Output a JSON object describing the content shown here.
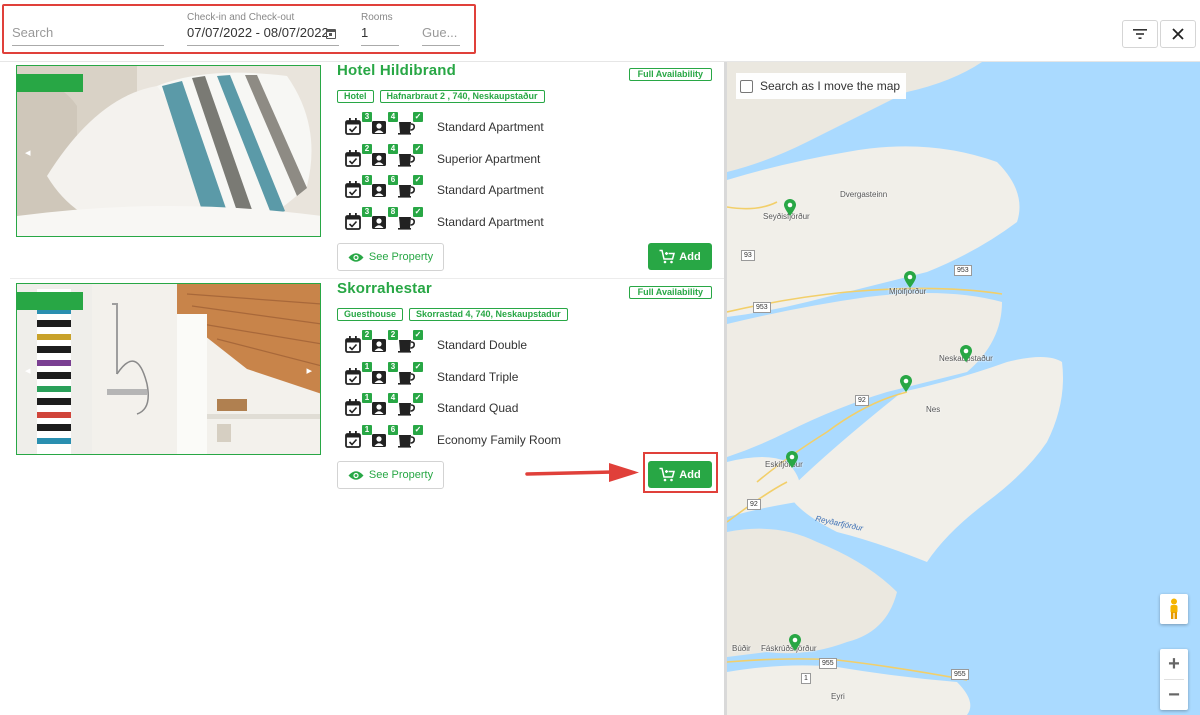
{
  "topbar": {
    "search": {
      "placeholder": "Search",
      "value": ""
    },
    "dates": {
      "label": "Check-in and Check-out",
      "value": "07/07/2022 - 08/07/2022"
    },
    "rooms": {
      "label": "Rooms",
      "value": "1"
    },
    "guests": {
      "placeholder": "Gue..."
    },
    "filter_icon": "filter-icon",
    "close_icon": "close-icon"
  },
  "properties": [
    {
      "name": "Hotel Hildibrand",
      "availability": "Full Availability",
      "type": "Hotel",
      "address": "Hafnarbraut 2 , 740, Neskaupstaður",
      "rooms": [
        {
          "name": "Standard Apartment",
          "a": "3",
          "b": "4"
        },
        {
          "name": "Superior Apartment",
          "a": "2",
          "b": "4"
        },
        {
          "name": "Standard Apartment",
          "a": "3",
          "b": "6"
        },
        {
          "name": "Standard Apartment",
          "a": "3",
          "b": "8"
        }
      ],
      "see_label": "See Property",
      "add_label": "Add"
    },
    {
      "name": "Skorrahestar",
      "availability": "Full Availability",
      "type": "Guesthouse",
      "address": "Skorrastad 4, 740, Neskaupstadur",
      "rooms": [
        {
          "name": "Standard Double",
          "a": "2",
          "b": "2"
        },
        {
          "name": "Standard Triple",
          "a": "1",
          "b": "3"
        },
        {
          "name": "Standard Quad",
          "a": "1",
          "b": "4"
        },
        {
          "name": "Economy Family Room",
          "a": "1",
          "b": "6"
        }
      ],
      "see_label": "See Property",
      "add_label": "Add"
    }
  ],
  "map": {
    "search_toggle_label": "Search as I move the map",
    "labels": {
      "seydisfjordur": "Seyðisfjörður",
      "dvergasteinn": "Dvergasteinn",
      "mjoifjordur": "Mjóifjörður",
      "neskaupstadur": "Neskaupstaður",
      "nes": "Nes",
      "eskifjordur": "Eskifjörður",
      "reydarfjordur": "Reyðarfjörður",
      "budir": "Búðir",
      "faskrudsfjordur": "Fáskrúðsfjörður",
      "eyri": "Eyri"
    },
    "roads": {
      "r93": "93",
      "r953a": "953",
      "r953b": "953",
      "r92a": "92",
      "r92b": "92",
      "r955a": "955",
      "r955b": "955",
      "r1": "1"
    },
    "zoom_in": "+",
    "zoom_out": "−"
  },
  "colors": {
    "accent": "#28a745",
    "highlight": "#e0403a",
    "water": "#aadaff",
    "land": "#f1efe9"
  }
}
